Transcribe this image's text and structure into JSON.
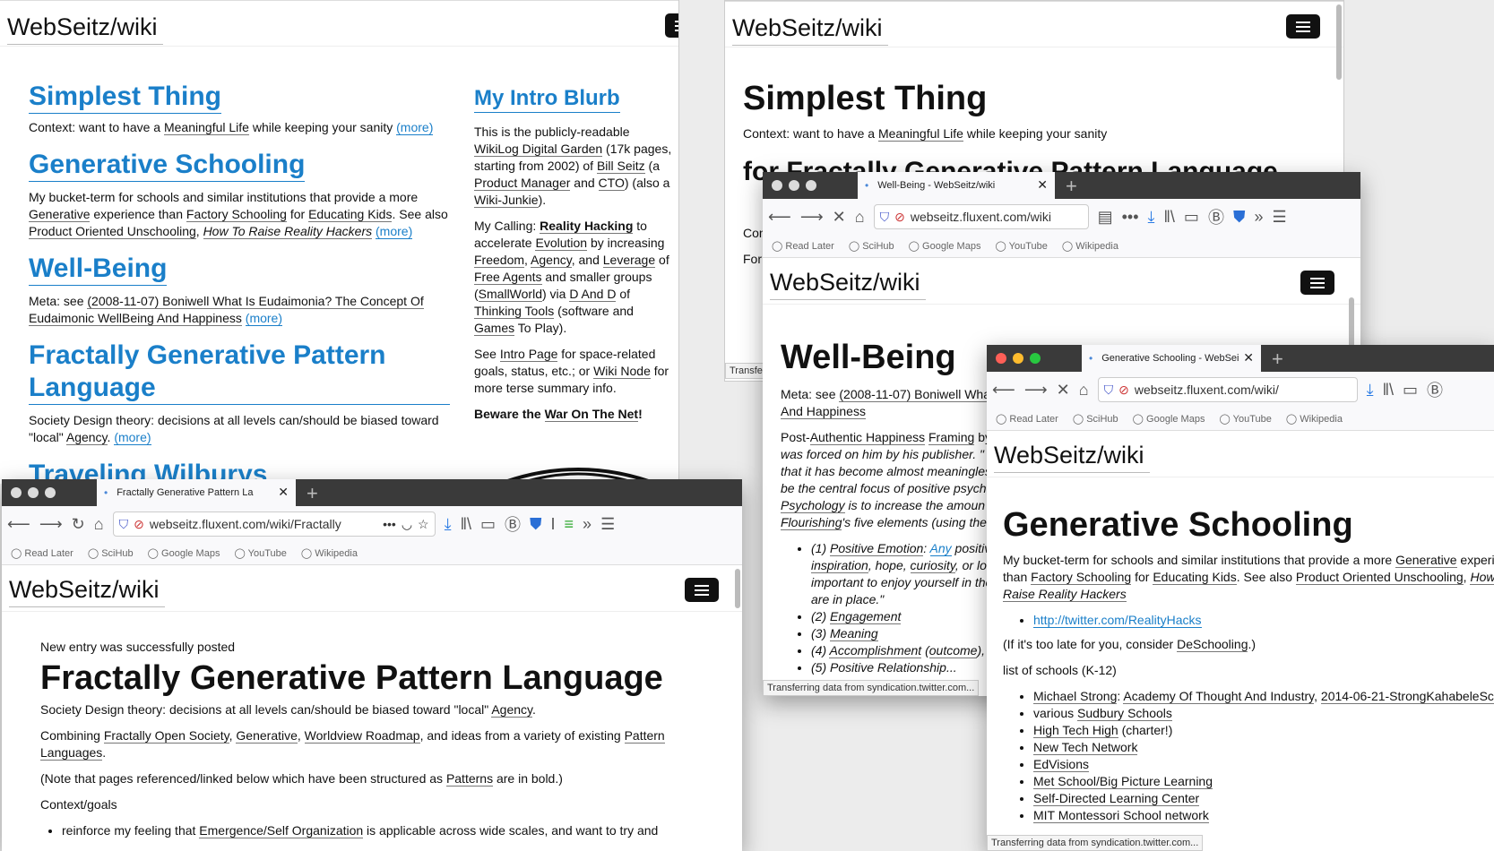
{
  "site": {
    "logo": "WebSeitz/wiki"
  },
  "w1": {
    "s1_title": "Simplest Thing",
    "s1_ctx_pre": "Context: want to have a ",
    "s1_ctx_link": "Meaningful Life",
    "s1_ctx_post": " while keeping your sanity ",
    "more": "(more)",
    "s2_title": "Generative Schooling",
    "s2_a": "My bucket-term for schools and similar institutions that provide a more ",
    "s2_l1": "Generative",
    "s2_b": " experience than ",
    "s2_l2": "Factory Schooling",
    "s2_c": " for ",
    "s2_l3": "Educating Kids",
    "s2_d": ". See also ",
    "s2_l4": "Product Oriented Unschooling",
    "s2_e": ", ",
    "s2_l5": "How To Raise Reality Hackers",
    "s3_title": "Well-Being",
    "s3_a": "Meta: see ",
    "s3_l1": "(2008-11-07) Boniwell What Is Eudaimonia? The Concept Of Eudaimonic WellBeing And Happiness",
    "s4_title": "Fractally Generative Pattern Language",
    "s4_a": "Society Design theory: decisions at all levels can/should be biased toward \"local\" ",
    "s4_l1": "Agency",
    "s4_b": ". ",
    "s5_title": "Traveling Wilburys",
    "side_title": "My Intro Blurb",
    "side_p1a": "This is the publicly-readable ",
    "side_p1l1": "WikiLog Digital Garden",
    "side_p1b": " (17k pages, starting from 2002) of ",
    "side_p1l2": "Bill Seitz",
    "side_p1c": " (a ",
    "side_p1l3": "Product Manager",
    "side_p1d": " and ",
    "side_p1l4": "CTO",
    "side_p1e": ") (also a ",
    "side_p1l5": "Wiki-Junkie",
    "side_p1f": ").",
    "side_p2a": "My Calling: ",
    "side_p2l1": "Reality Hacking",
    "side_p2b": " to accelerate ",
    "side_p2l2": "Evolution",
    "side_p2c": " by increasing ",
    "side_p2l3": "Freedom",
    "side_p2d": ", ",
    "side_p2l4": "Agency",
    "side_p2e": ", and ",
    "side_p2l5": "Leverage",
    "side_p2f": " of ",
    "side_p2l6": "Free Agents",
    "side_p2g": " and smaller groups (",
    "side_p2l7": "SmallWorld",
    "side_p2h": ") via ",
    "side_p2l8": "D And D",
    "side_p2i": " of ",
    "side_p2l9": "Thinking Tools",
    "side_p2j": " (software and ",
    "side_p2l10": "Games",
    "side_p2k": " To Play).",
    "side_p3a": "See ",
    "side_p3l1": "Intro Page",
    "side_p3b": " for space-related goals, status, etc.; or ",
    "side_p3l2": "Wiki Node",
    "side_p3c": " for more terse summary info.",
    "side_p4a": "Beware the ",
    "side_p4l1": "War On The Net",
    "side_p4b": "!"
  },
  "w2": {
    "title": "Simplest Thing",
    "ctx_pre": "Context: want to have a ",
    "ctx_link": "Meaningful Life",
    "ctx_post": " while keeping your sanity",
    "h2": "for Fractally Generative Pattern Language",
    "con": "Con",
    "for": "For",
    "status": "Transfe"
  },
  "browser": {
    "read_later": "Read Later",
    "scihub": "SciHub",
    "maps": "Google Maps",
    "youtube": "YouTube",
    "wikipedia": "Wikipedia"
  },
  "w3": {
    "tab": "Well-Being - WebSeitz/wiki",
    "url": "webseitz.fluxent.com/wiki",
    "title": "Well-Being",
    "meta_a": "Meta: see ",
    "meta_l": "(2008-11-07) Boniwell What Is Eudaimonia? The Concept Of Eudaimonic WellBeing",
    "meta_b": "And Happiness",
    "p2a": "Post-",
    "p2l1": "Authentic Happiness",
    "p2l2": "Framing",
    "p2b": " by",
    "p2c": "was forced on him by his publisher. \"",
    "p2d": "that it has become almost meaningles",
    "p2e": "be the central focus of positive psych",
    "p2l3": "Psychology",
    "p2f": " is to increase the amoun",
    "p2l4": "Flourishing",
    "p2g": "'s five elements (using the",
    "li1a": "(1) ",
    "li1l1": "Positive Emotion",
    "li1b": ": ",
    "li1l2": "Any",
    "li1c": " positive",
    "li1d": "inspiration",
    "li1e": ", hope, ",
    "li1l3": "curiosity",
    "li1f": ", or lov",
    "li1g": "important to enjoy yourself in the",
    "li1h": "are in place.\"",
    "li2a": "(2) ",
    "li2l": "Engagement",
    "li3a": "(3) ",
    "li3l": "Meaning",
    "li4a": "(4) ",
    "li4l": "Accomplishment",
    "li4b": " (",
    "li4l2": "outcome",
    "li4c": "),",
    "li5": "(5) Positive Relationship...",
    "status": "Transferring data from syndication.twitter.com..."
  },
  "w4": {
    "tab": "Generative Schooling - WebSei",
    "url": "webseitz.fluxent.com/wiki/",
    "title": "Generative Schooling",
    "p1a": "My bucket-term for schools and similar institutions that provide a more ",
    "p1l1": "Generative",
    "p1b": " experi",
    "p1c": "than ",
    "p1l2": "Factory Schooling",
    "p1d": " for ",
    "p1l3": "Educating Kids",
    "p1e": ". See also ",
    "p1l4": "Product Oriented Unschooling",
    "p1f": ", ",
    "p1l5": "How",
    "p1l6": "Raise Reality Hackers",
    "link": "http://twitter.com/RealityHacks",
    "p2a": "(If it's too late for you, consider ",
    "p2l": "DeSchooling",
    "p2b": ".)",
    "p3": "list of schools (K-12)",
    "li1l1": "Michael Strong",
    "li1a": ": ",
    "li1l2": "Academy Of Thought And Industry",
    "li1b": ", ",
    "li1l3": "2014-06-21-StrongKahabeleSch",
    "li2a": "various ",
    "li2l": "Sudbury Schools",
    "li3l": "High Tech High",
    "li3a": " (charter!)",
    "li4l": "New Tech Network",
    "li5l": "EdVisions",
    "li6l": "Met School/Big Picture Learning",
    "li7l": "Self-Directed Learning Center",
    "li8l": "MIT Montessori School network",
    "status": "Transferring data from syndication.twitter.com..."
  },
  "w5": {
    "tab": "Fractally Generative Pattern La",
    "url": "webseitz.fluxent.com/wiki/Fractally",
    "notice": "New entry was successfully posted",
    "title": "Fractally Generative Pattern Language",
    "p1a": "Society Design theory: decisions at all levels can/should be biased toward \"local\" ",
    "p1l": "Agency",
    "p1b": ".",
    "p2a": "Combining ",
    "p2l1": "Fractally Open Society",
    "p2b": ", ",
    "p2l2": "Generative",
    "p2c": ", ",
    "p2l3": "Worldview Roadmap",
    "p2d": ", and ideas from a variety of existing ",
    "p2l4": "Pattern Languages",
    "p2e": ".",
    "p3a": "(Note that pages referenced/linked below which have been structured as ",
    "p3l": "Patterns",
    "p3b": " are in bold.)",
    "p4": "Context/goals",
    "li1a": "reinforce my feeling that ",
    "li1l": "Emergence/Self Organization",
    "li1b": " is applicable across wide scales, and want to try and"
  }
}
